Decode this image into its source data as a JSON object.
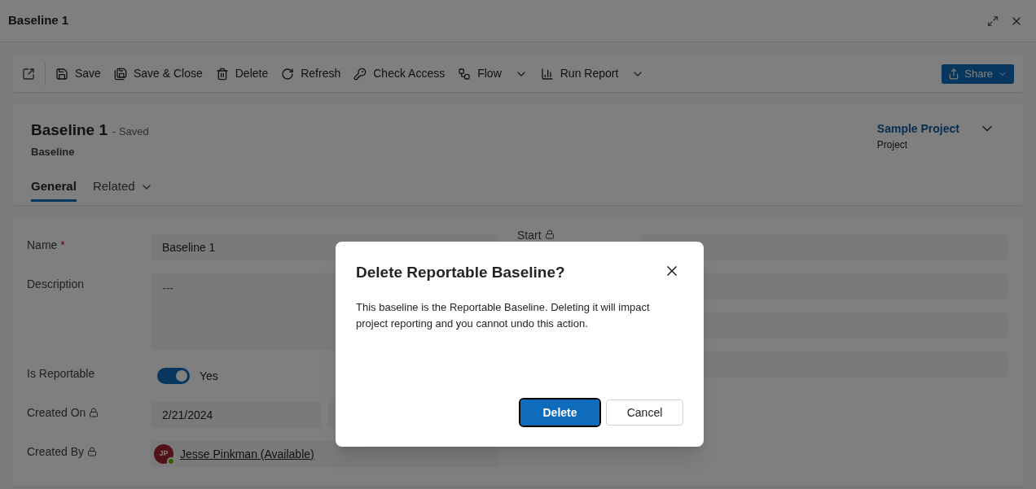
{
  "window": {
    "title": "Baseline 1"
  },
  "toolbar": {
    "items": [
      {
        "label": "Save",
        "kind": "button"
      },
      {
        "label": "Save & Close",
        "kind": "button"
      },
      {
        "label": "Delete",
        "kind": "button"
      },
      {
        "label": "Refresh",
        "kind": "button"
      },
      {
        "label": "Check Access",
        "kind": "button"
      },
      {
        "label": "Flow",
        "kind": "menu"
      },
      {
        "label": "Run Report",
        "kind": "menu"
      }
    ],
    "share": "Share"
  },
  "header": {
    "title": "Baseline 1",
    "status": "- Saved",
    "entity": "Baseline",
    "project": {
      "name": "Sample Project",
      "type": "Project"
    }
  },
  "tabs": [
    {
      "label": "General",
      "selected": true,
      "kind": "tab"
    },
    {
      "label": "Related",
      "selected": false,
      "kind": "menu"
    }
  ],
  "form": {
    "left": [
      {
        "kind": "text",
        "label": "Name",
        "required": true,
        "locked": false,
        "value": "Baseline 1"
      },
      {
        "kind": "multiline",
        "label": "Description",
        "required": false,
        "locked": false,
        "value": "---"
      },
      {
        "kind": "toggle",
        "label": "Is Reportable",
        "required": false,
        "locked": false,
        "on": true,
        "value": "Yes"
      },
      {
        "kind": "datetime",
        "label": "Created On",
        "required": false,
        "locked": true,
        "value": "2/21/2024"
      },
      {
        "kind": "person",
        "label": "Created By",
        "required": false,
        "locked": true,
        "initials": "JP",
        "value": "Jesse Pinkman (Available)"
      }
    ],
    "required_mark": "*",
    "right_label": "Start"
  },
  "dialog": {
    "title": "Delete Reportable Baseline?",
    "message": "This baseline is the Reportable Baseline. Deleting it will impact project reporting and you cannot undo this action.",
    "buttons": [
      {
        "label": "Delete",
        "kind": "primary"
      },
      {
        "label": "Cancel",
        "kind": "secondary"
      }
    ]
  }
}
